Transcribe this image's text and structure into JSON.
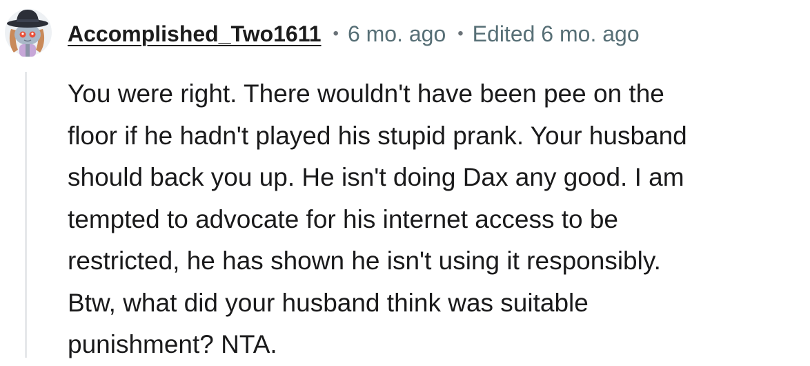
{
  "comment": {
    "username": "Accomplished_Two1611",
    "time_ago": "6 mo. ago",
    "edited": "Edited 6 mo. ago",
    "separator": "•",
    "avatar_icon": "reddit-snoo-cowboy-avatar-icon",
    "body_lines": [
      "You were right. There wouldn't have been pee on the",
      "floor if he hadn't played his stupid prank. Your husband",
      "should back you up. He isn't doing Dax any good. I am",
      "tempted to advocate for his internet access to be",
      "restricted, he has shown he isn't using it responsibly.",
      "Btw, what did your husband think was suitable",
      "punishment? NTA."
    ]
  },
  "colors": {
    "username": "#1c1c1c",
    "meta": "#576f76",
    "body": "#1a1a1b",
    "thread_line": "#e6e8ea"
  }
}
